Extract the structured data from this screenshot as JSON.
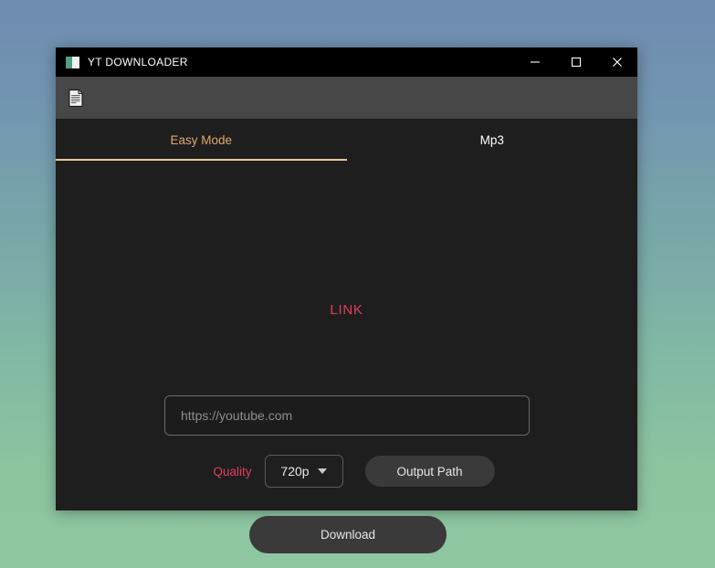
{
  "window": {
    "title": "YT DOWNLOADER",
    "app_icon": "window-app-icon",
    "controls": {
      "minimize": "minimize-icon",
      "maximize": "maximize-icon",
      "close": "close-icon"
    }
  },
  "toolbar": {
    "items": [
      {
        "icon": "document-icon",
        "label": ""
      }
    ]
  },
  "tabs": [
    {
      "label": "Easy Mode",
      "active": true
    },
    {
      "label": "Mp3",
      "active": false
    }
  ],
  "main": {
    "link_label": "LINK",
    "url_input": {
      "value": "",
      "placeholder": "https://youtube.com"
    },
    "quality_label": "Quality",
    "quality_value": "720p",
    "quality_caret": "chevron-down-icon",
    "output_path_label": "Output Path",
    "download_label": "Download"
  },
  "colors": {
    "accent_tab": "#e0a96d",
    "accent_underline": "#e8c89a",
    "label_red": "#e03f5e",
    "window_bg": "#1e1e1e",
    "toolbar_bg": "#474747",
    "titlebar_bg": "#000000",
    "button_bg": "#3a3a3a"
  }
}
